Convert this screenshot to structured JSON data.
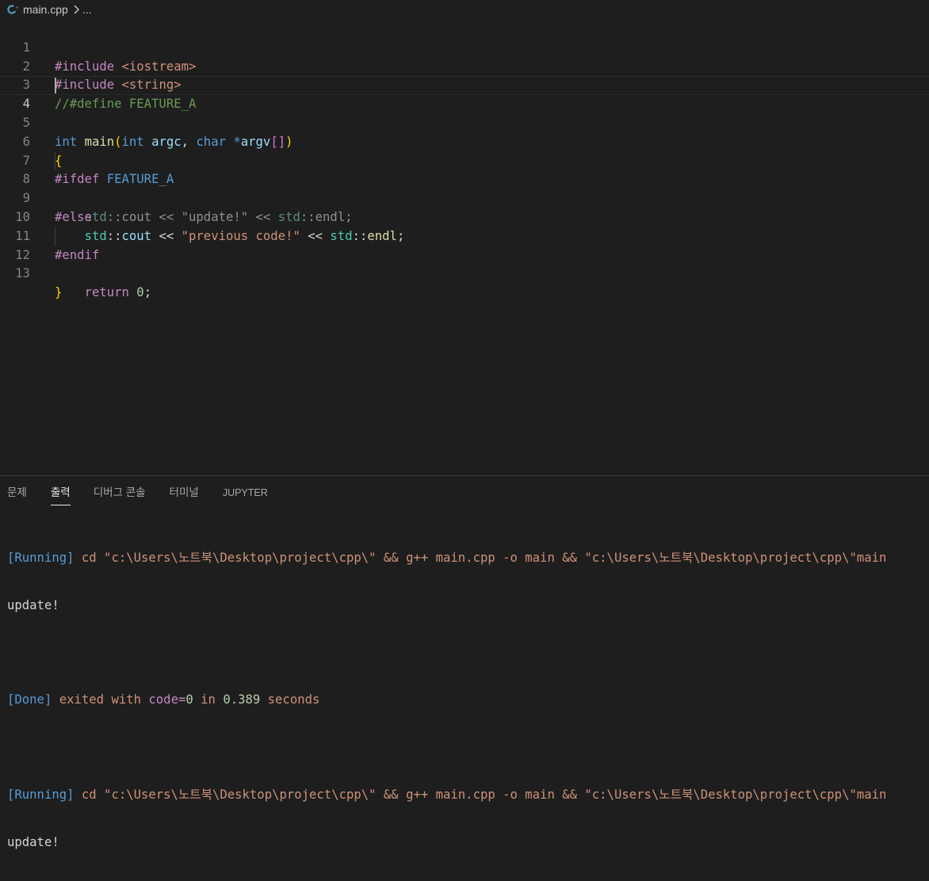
{
  "breadcrumb": {
    "file": "main.cpp",
    "more": "..."
  },
  "editor": {
    "line_numbers": [
      "1",
      "2",
      "3",
      "4",
      "5",
      "6",
      "7",
      "8",
      "9",
      "10",
      "11",
      "12",
      "13"
    ],
    "tokens": {
      "include": "#include",
      "iostream": "<iostream>",
      "string": "<string>",
      "define_comment": "//#define FEATURE_A",
      "int": "int",
      "main": "main",
      "lparen": "(",
      "argc": "argc",
      "comma": ",",
      "char": "char",
      "star": "*",
      "argv": "argv",
      "brackets": "[]",
      "rparen": ")",
      "open_brace": "{",
      "close_brace": "}",
      "ifdef": "#ifdef",
      "feature": "FEATURE_A",
      "std": "std",
      "scope": "::",
      "cout": "cout",
      "shift": "<<",
      "update_str": "\"update!\"",
      "endl": "endl",
      "semi": ";",
      "else": "#else",
      "previous_str": "\"previous code!\"",
      "endif": "#endif",
      "return": "return",
      "zero": "0"
    }
  },
  "panel": {
    "tabs": [
      "문제",
      "출력",
      "디버그 콘솔",
      "터미널",
      "JUPYTER"
    ],
    "active_tab": "출력",
    "output": {
      "running_tag": "[Running]",
      "command": "cd \"c:\\Users\\노트북\\Desktop\\project\\cpp\\\" && g++ main.cpp -o main && \"c:\\Users\\노트북\\Desktop\\project\\cpp\\\"main",
      "result": "update!",
      "done_tag": "[Done]",
      "exited_text": "exited with",
      "code_label": "code=",
      "code_value": "0",
      "in_text": "in",
      "time_value": "0.389",
      "seconds_text": "seconds"
    }
  },
  "colors": {
    "background": "#1e1e1e",
    "line_number": "#858585",
    "keyword": "#569cd6",
    "preprocessor": "#c586c0",
    "string": "#ce9178",
    "comment": "#6a9955",
    "function": "#dcdcaa",
    "variable": "#9cdcfe",
    "namespace": "#4ec9b0",
    "number": "#b5cea8",
    "brace": "#ffd700"
  }
}
